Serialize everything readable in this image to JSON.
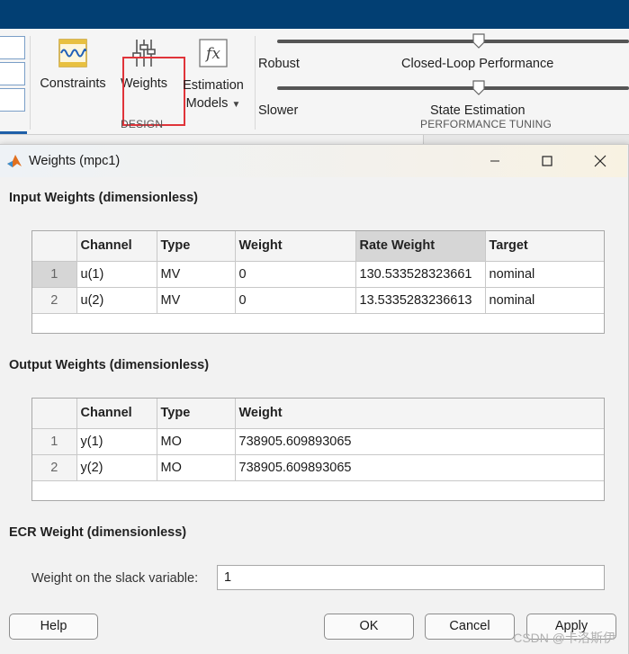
{
  "toolstrip": {
    "constraints_label": "Constraints",
    "weights_label": "Weights",
    "estimation_line1": "Estimation",
    "estimation_line2": "Models",
    "design_section": "DESIGN",
    "slider1_left": "Robust",
    "slider1_right": "Closed-Loop Performance",
    "slider2_left": "Slower",
    "slider2_right": "State Estimation",
    "tuning_section": "PERFORMANCE TUNING",
    "fx_glyph": "fx"
  },
  "dialog": {
    "title": "Weights (mpc1)",
    "input_section": "Input Weights (dimensionless)",
    "input_headers": {
      "channel": "Channel",
      "type": "Type",
      "weight": "Weight",
      "rate_weight": "Rate Weight",
      "target": "Target"
    },
    "input_rows": [
      {
        "num": "1",
        "channel": "u(1)",
        "type": "MV",
        "weight": "0",
        "rate_weight": "130.533528323661",
        "target": "nominal"
      },
      {
        "num": "2",
        "channel": "u(2)",
        "type": "MV",
        "weight": "0",
        "rate_weight": "13.5335283236613",
        "target": "nominal"
      }
    ],
    "output_section": "Output Weights (dimensionless)",
    "output_headers": {
      "channel": "Channel",
      "type": "Type",
      "weight": "Weight"
    },
    "output_rows": [
      {
        "num": "1",
        "channel": "y(1)",
        "type": "MO",
        "weight": "738905.609893065"
      },
      {
        "num": "2",
        "channel": "y(2)",
        "type": "MO",
        "weight": "738905.609893065"
      }
    ],
    "ecr_section": "ECR Weight (dimensionless)",
    "slack_label": "Weight on the slack variable:",
    "slack_value": "1",
    "buttons": {
      "help": "Help",
      "ok": "OK",
      "cancel": "Cancel",
      "apply": "Apply"
    }
  },
  "watermark": "CSDN @卡洛斯伊",
  "colors": {
    "title_bar": "#023f73",
    "highlight": "#e0343a",
    "selected_cell": "#d6d6d6"
  }
}
